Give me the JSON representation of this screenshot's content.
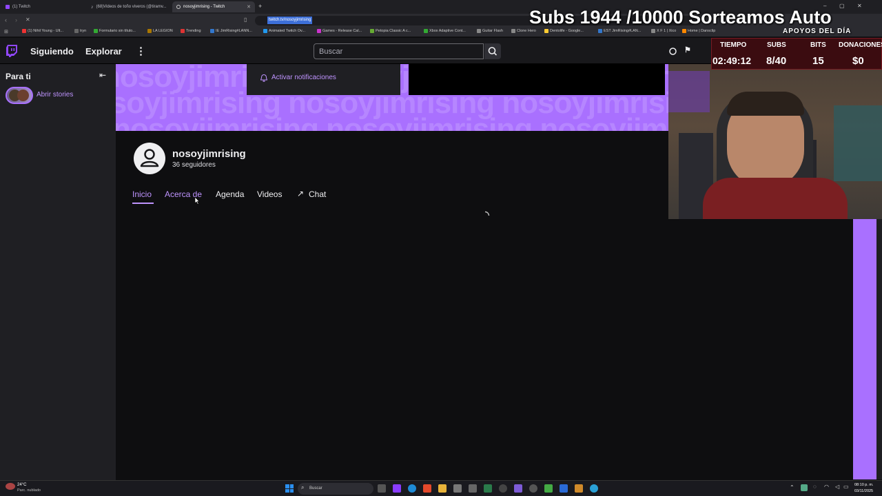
{
  "browser": {
    "tabs": [
      {
        "title": "(1) Twitch"
      },
      {
        "title": "(68)Videos de toño viveros (@tiramv..."
      },
      {
        "title": "nosoyjimrising - Twitch"
      }
    ],
    "url": "twitch.tv/nosoyjimrising",
    "bookmarks": [
      "(1) Nihil Young - Ult...",
      "tryn",
      "Formulario sin título...",
      "LA LEGION",
      "Trending",
      "IE JimRising#LANN...",
      "Animated Twitch Ov...",
      "Games - Release Cal...",
      "Petopia Classic A c...",
      "Xbox Adaptive Cont...",
      "Guitar Flash",
      "Clone Hero",
      "Dentolife - Google...",
      "EST JimRising#LAN...",
      "X F 1 | Xico",
      "Home | Dansclip"
    ]
  },
  "nav": {
    "following": "Siguiendo",
    "browse": "Explorar",
    "search_placeholder": "Buscar"
  },
  "sidebar": {
    "header": "Para ti",
    "stories_label": "Abrir stories"
  },
  "notify": {
    "label": "Activar notificaciones"
  },
  "banner": {
    "text": "nosoyjimrising nosoyjimrising nosoyjimrising"
  },
  "channel": {
    "name": "nosoyjimrising",
    "followers": "36 seguidores",
    "tabs": [
      {
        "label": "Inicio",
        "active": true
      },
      {
        "label": "Acerca de"
      },
      {
        "label": "Agenda"
      },
      {
        "label": "Videos"
      },
      {
        "label": "Chat"
      }
    ]
  },
  "overlay": {
    "headline": "Subs 1944 /10000 Sorteamos Auto",
    "apoyos": "APOYOS DEL DÍA",
    "stats": [
      {
        "label": "TIEMPO",
        "value": "02:49:12"
      },
      {
        "label": "SUBS",
        "value": "8/40"
      },
      {
        "label": "BITS",
        "value": "15"
      },
      {
        "label": "DONACIONES",
        "value": "$0"
      }
    ]
  },
  "taskbar": {
    "weather_temp": "24°C",
    "weather_desc": "Parc. nublado",
    "search_label": "Buscar",
    "time": "08:10 p. m.",
    "date": "03/11/2025"
  },
  "colors": {
    "twitch_purple": "#a970ff",
    "bg": "#0e0e10",
    "nav_bg": "#18181b",
    "sidebar_bg": "#1f1f23"
  }
}
